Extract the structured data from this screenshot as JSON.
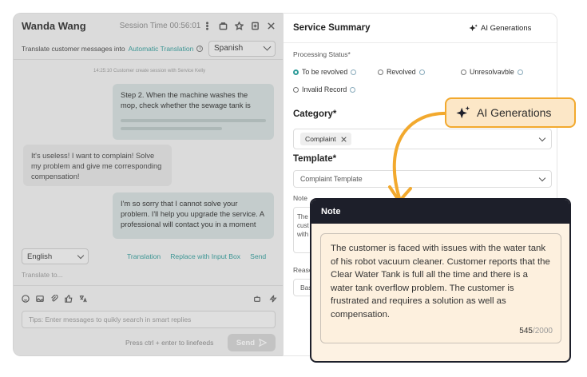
{
  "chat": {
    "agent_name": "Wanda Wang",
    "session_time": "Session Time 00:56:01",
    "translate_label": "Translate customer messages into",
    "auto_translation": "Automatic Translation",
    "target_language": "Spanish",
    "system_note": "14:25:10   Customer create session with Service Kelly",
    "messages": [
      {
        "side": "agent",
        "text": "Step 2. When the machine washes the mop, check whether the sewage tank is"
      },
      {
        "side": "customer",
        "text": "It's useless! I want to complain! Solve my problem and give me corresponding compensation!"
      },
      {
        "side": "agent",
        "text": "I'm so sorry that I cannot solve your problem. I'll help you upgrade the service. A professional will contact you in a moment"
      }
    ],
    "reply_language": "English",
    "translation_link": "Translation",
    "replace_link": "Replace with Input Box",
    "send_link": "Send",
    "translate_to_placeholder": "Translate to...",
    "search_placeholder": "Tips: Enter messages to quikly search in smart replies",
    "linefeed_hint": "Press ctrl + enter to linefeeds",
    "send_button": "Send"
  },
  "summary": {
    "title": "Service Summary",
    "ai_button": "AI Generations",
    "processing_status_label": "Processing Status*",
    "statuses": [
      {
        "label": "To be revolved",
        "selected": true
      },
      {
        "label": "Revolved",
        "selected": false
      },
      {
        "label": "Unresolvavble",
        "selected": false
      },
      {
        "label": "Invalid Record",
        "selected": false
      }
    ],
    "category_label": "Category*",
    "category_tag": "Complaint",
    "template_label": "Template*",
    "template_value": "Complaint Template",
    "note_label": "Note",
    "note_preview": "The cust with",
    "reason_label": "Reaso",
    "reason_value": "Bas"
  },
  "callout": {
    "label": "AI Generations"
  },
  "note_popup": {
    "title": "Note",
    "text": "The customer is faced with issues with the water tank of his robot vacuum cleaner. Customer reports that the Clear Water Tank is full all the time and there is a water tank overflow problem. The customer is frustrated and requires a solution as well as compensation.",
    "count": "545",
    "max": "/2000"
  },
  "colors": {
    "accent": "#2f9c9a",
    "callout_fill": "#fce7c7",
    "callout_border": "#f2a92e",
    "popup_header": "#1d1f2a"
  }
}
